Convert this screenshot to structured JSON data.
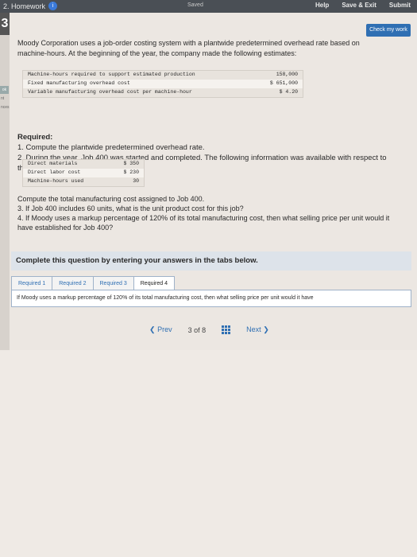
{
  "topbar": {
    "assignment": "2. Homework",
    "badge": "i",
    "saved": "Saved",
    "help": "Help",
    "save_exit": "Save & Exit",
    "submit": "Submit"
  },
  "sidebar": {
    "question_number": "3",
    "ebook": "ok",
    "points": "nt",
    "references": "nces"
  },
  "check_my_work": "Check my work",
  "intro": "Moody Corporation uses a job-order costing system with a plantwide predetermined overhead rate based on machine-hours. At the beginning of the year, the company made the following estimates:",
  "estimates": [
    {
      "label": "Machine-hours required to support estimated production",
      "value": "158,000"
    },
    {
      "label": "Fixed manufacturing overhead cost",
      "value": "$ 651,000"
    },
    {
      "label": "Variable manufacturing overhead cost per machine-hour",
      "value": "$ 4.20"
    }
  ],
  "required": {
    "heading": "Required:",
    "item1": "1. Compute the plantwide predetermined overhead rate.",
    "item2": "2. During the year, Job 400 was started and completed. The following information was available with respect to this job:"
  },
  "job400": [
    {
      "label": "Direct materials",
      "value": "$ 350"
    },
    {
      "label": "Direct labor cost",
      "value": "$ 230"
    },
    {
      "label": "Machine-hours used",
      "value": "30"
    }
  ],
  "questions": {
    "q1": "Compute the total manufacturing cost assigned to Job 400.",
    "q3": "3. If Job 400 includes 60 units, what is the unit product cost for this job?",
    "q4": "4. If Moody uses a markup percentage of 120% of its total manufacturing cost, then what selling price per unit would it have established for Job 400?"
  },
  "complete_banner": "Complete this question by entering your answers in the tabs below.",
  "tabs": [
    {
      "label": "Required 1"
    },
    {
      "label": "Required 2"
    },
    {
      "label": "Required 3"
    },
    {
      "label": "Required 4"
    }
  ],
  "panel_text": "If Moody uses a markup percentage of 120% of its total manufacturing cost, then what selling price per unit would it have",
  "nav": {
    "prev": "Prev",
    "current": "3",
    "of": "of",
    "total": "8",
    "next": "Next"
  }
}
